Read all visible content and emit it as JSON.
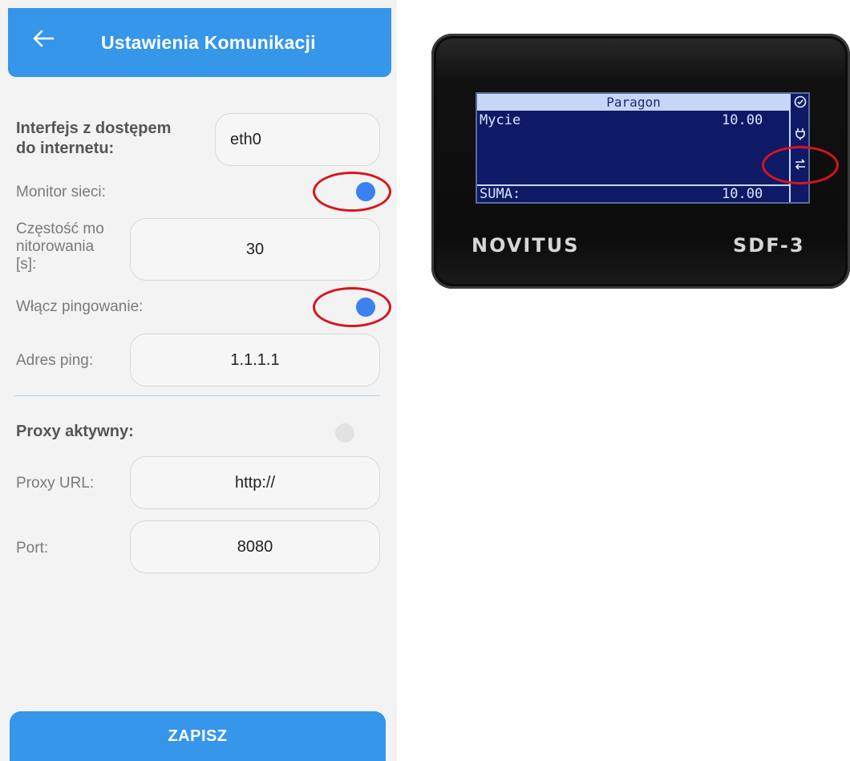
{
  "appbar": {
    "title": "Ustawienia Komunikacji",
    "back_icon": "arrow-left-icon"
  },
  "form": {
    "interface": {
      "label_line1": "Interfejs z dostępem",
      "label_line2": "do internetu:",
      "value": "eth0"
    },
    "network_monitor": {
      "label": "Monitor sieci:",
      "enabled": true
    },
    "monitor_frequency": {
      "label_line1": "Częstość mo",
      "label_line2": "nitorowania",
      "label_line3": "[s]:",
      "value": "30"
    },
    "ping_enabled": {
      "label": "Włącz pingowanie:",
      "enabled": true
    },
    "ping_address": {
      "label": "Adres ping:",
      "value": "1.1.1.1"
    },
    "proxy_active": {
      "label": "Proxy aktywny:",
      "enabled": false
    },
    "proxy_url": {
      "label": "Proxy URL:",
      "value": "http://"
    },
    "port": {
      "label": "Port:",
      "value": "8080"
    }
  },
  "save_button": {
    "label": "ZAPISZ"
  },
  "device": {
    "lcd_header": "Paragon",
    "item_name": "Mycie",
    "item_price": "10.00",
    "sum_label": "SUMA:",
    "sum_value": "10.00",
    "status_icons": [
      "check-circle-icon",
      "plug-icon",
      "transfer-arrows-icon"
    ],
    "brand": "NOVITUS",
    "model": "SDF-3"
  },
  "colors": {
    "accent": "#3596ea",
    "toggle_on": "#3b82f0",
    "highlight_ring": "#d8141d",
    "lcd_background": "#0f1a66"
  }
}
